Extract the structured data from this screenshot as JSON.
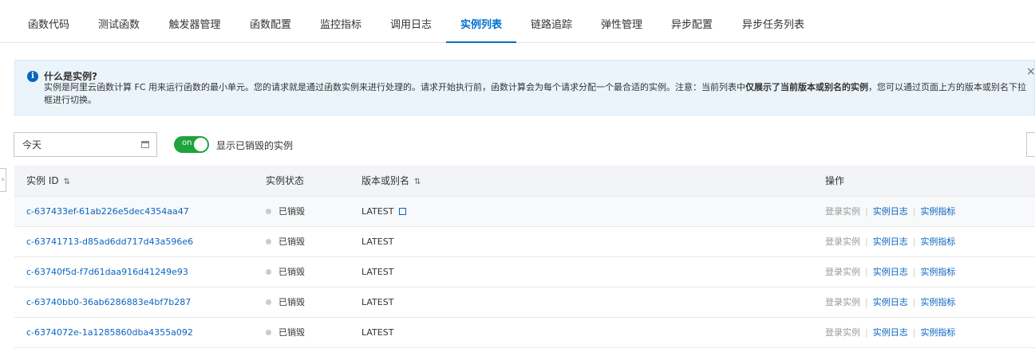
{
  "tabs": [
    {
      "label": "函数代码",
      "active": false
    },
    {
      "label": "测试函数",
      "active": false
    },
    {
      "label": "触发器管理",
      "active": false
    },
    {
      "label": "函数配置",
      "active": false
    },
    {
      "label": "监控指标",
      "active": false
    },
    {
      "label": "调用日志",
      "active": false
    },
    {
      "label": "实例列表",
      "active": true
    },
    {
      "label": "链路追踪",
      "active": false
    },
    {
      "label": "弹性管理",
      "active": false
    },
    {
      "label": "异步配置",
      "active": false
    },
    {
      "label": "异步任务列表",
      "active": false
    }
  ],
  "notice": {
    "icon": "info-icon",
    "title": "什么是实例?",
    "text_part1": "实例是阿里云函数计算 FC 用来运行函数的最小单元。您的请求就是通过函数实例来进行处理的。请求开始执行前，函数计算会为每个请求分配一个最合适的实例。注意：当前列表中",
    "text_bold": "仅展示了当前版本或别名的实例",
    "text_part2": "，您可以通过页面上方的版本或别名下拉框进行切换。",
    "close": "×"
  },
  "filters": {
    "date_value": "今天",
    "toggle_text": "on",
    "toggle_on": true,
    "toggle_label": "显示已销毁的实例"
  },
  "table": {
    "headers": {
      "instance_id": "实例 ID",
      "status": "实例状态",
      "version": "版本或别名",
      "actions": "操作"
    },
    "sort_icon": "⇅",
    "rows": [
      {
        "id": "c-637433ef-61ab226e5dec4354aa47",
        "status": "已销毁",
        "version": "LATEST",
        "external_link": true
      },
      {
        "id": "c-63741713-d85ad6dd717d43a596e6",
        "status": "已销毁",
        "version": "LATEST",
        "external_link": false
      },
      {
        "id": "c-63740f5d-f7d61daa916d41249e93",
        "status": "已销毁",
        "version": "LATEST",
        "external_link": false
      },
      {
        "id": "c-63740bb0-36ab6286883e4bf7b287",
        "status": "已销毁",
        "version": "LATEST",
        "external_link": false
      },
      {
        "id": "c-6374072e-1a1285860dba4355a092",
        "status": "已销毁",
        "version": "LATEST",
        "external_link": false
      }
    ],
    "actions": {
      "login": "登录实例",
      "logs": "实例日志",
      "metrics": "实例指标",
      "separator": "|"
    }
  },
  "colors": {
    "accent": "#0070cc",
    "link": "#0a64c2",
    "toggle_on": "#1fa33d",
    "notice_bg": "#ebf4fb"
  }
}
